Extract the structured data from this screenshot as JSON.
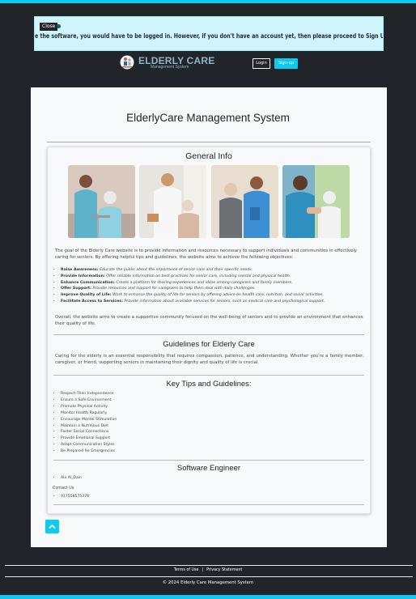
{
  "notice": {
    "close_label": "Close",
    "message": "e the software, you would have to be logged in. However, if you don't have an account yet, then please proceed to Sign Up."
  },
  "brand": {
    "name": "ELDERLY CARE",
    "tagline": "Management System"
  },
  "nav": {
    "login_label": "Login",
    "signup_label": "Sign-up"
  },
  "page": {
    "title": "ElderlyCare Management System"
  },
  "general": {
    "heading": "General Info",
    "intro": "The goal of the Elderly Care website is to provide information and resources necessary to support individuals and communities in effectively caring for seniors. By offering helpful tips and guidelines, the website aims to achieve the following objectives:",
    "objectives": [
      {
        "title": "Raise Awareness:",
        "text": "Educate the public about the importance of senior care and their specific needs."
      },
      {
        "title": "Provide Information:",
        "text": "Offer reliable information on best practices for senior care, including mental and physical health."
      },
      {
        "title": "Enhance Communication:",
        "text": "Create a platform for sharing experiences and ideas among caregivers and family members."
      },
      {
        "title": "Offer Support:",
        "text": "Provide resources and support for caregivers to help them deal with daily challenges."
      },
      {
        "title": "Improve Quality of Life:",
        "text": "Work to enhance the quality of life for seniors by offering advice on health care, nutrition, and social activities."
      },
      {
        "title": "Facilitate Access to Services:",
        "text": "Provide information about available services for seniors, such as medical care and psychological support."
      }
    ],
    "closing": "Overall, the website aims to create a supportive community focused on the well-being of seniors and to provide an environment that enhances their quality of life."
  },
  "guidelines": {
    "heading": "Guidelines for Elderly Care",
    "text": "Caring for the elderly is an essential responsibility that requires compassion, patience, and understanding. Whether you're a family member, caregiver, or friend, supporting seniors in maintaining their dignity and quality of life is crucial."
  },
  "tips": {
    "heading": "Key Tips and Guidelines:",
    "items": [
      "Respect Their Independence",
      "Ensure a Safe Environment",
      "Promote Physical Activity",
      "Monitor Health Regularly",
      "Encourage Mental Stimulation",
      "Maintain a Nutritious Diet",
      "Foster Social Connections",
      "Provide Emotional Support",
      "Adapt Communication Styles",
      "Be Prepared for Emergencies"
    ]
  },
  "engineer": {
    "heading": "Software Engineer",
    "name": "Ala Al_Dain",
    "contact_label": "Contact Us",
    "phone": "917558575378"
  },
  "footer": {
    "terms": "Terms of Use",
    "separator": "|",
    "privacy": "Privacy Statement",
    "copyright": "© 2024 Elderly Care Management System"
  },
  "colors": {
    "accent": "#0dcaf0",
    "background": "#212529",
    "notice_bg": "#cff4fc"
  }
}
